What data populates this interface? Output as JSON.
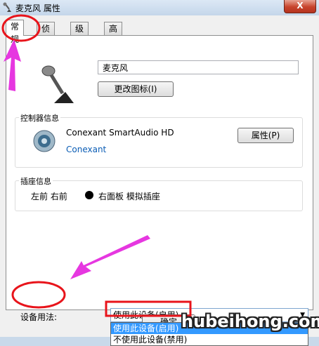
{
  "window": {
    "title": "麦克风 属性",
    "close_glyph": "X"
  },
  "tabs": [
    {
      "label": "常规",
      "active": true
    },
    {
      "label": "侦听",
      "active": false
    },
    {
      "label": "级别",
      "active": false
    },
    {
      "label": "高级",
      "active": false
    }
  ],
  "device": {
    "name": "麦克风",
    "change_icon_label": "更改图标(I)"
  },
  "controller": {
    "group_label": "控制器信息",
    "name": "Conexant SmartAudio HD",
    "vendor": "Conexant",
    "properties_label": "属性(P)"
  },
  "jack": {
    "group_label": "插座信息",
    "left_text": "左前 右前",
    "right_text": "右面板 模拟插座"
  },
  "usage": {
    "label": "设备用法:",
    "selected": "使用此设备(启用)",
    "options": [
      "使用此设备(启用)",
      "不使用此设备(禁用)"
    ]
  },
  "buttons": {
    "ok_partial": "确定"
  },
  "watermark": "hubeihong.com",
  "colors": {
    "annotation_red": "#e8141b",
    "annotation_magenta": "#e637e0",
    "selection_blue": "#3399ff"
  },
  "icons": {
    "title": "microphone-icon",
    "device": "microphone-icon",
    "controller": "audio-chip-icon"
  }
}
